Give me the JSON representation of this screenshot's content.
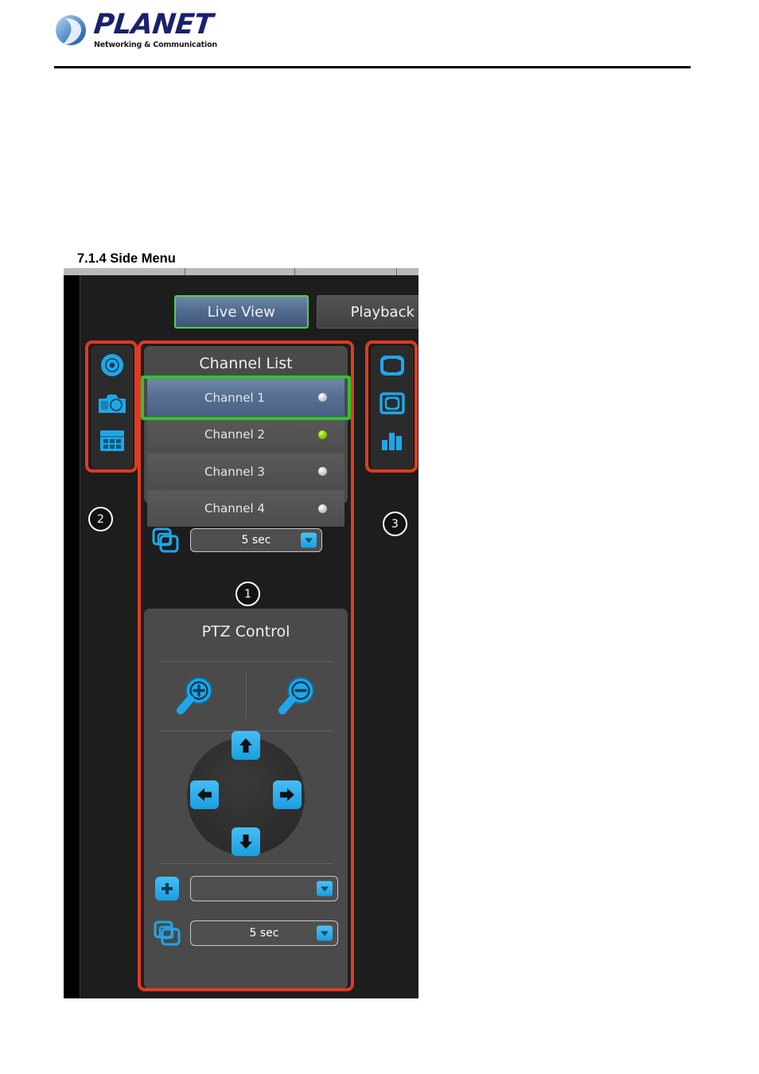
{
  "document": {
    "brand_name": "PLANET",
    "brand_tagline": "Networking & Communication",
    "section_heading": "7.1.4 Side Menu"
  },
  "colors": {
    "accent_blue": "#1a9fe0",
    "annotation_red": "#e03a22",
    "highlight_green": "#2fc42f",
    "status_on_green": "#8ed11a",
    "panel_gray": "#4a4a4a",
    "app_background": "#1d1d1d",
    "selected_row_blue": "#566f93"
  },
  "app": {
    "tabs": [
      {
        "label": "Live View",
        "state": "active"
      },
      {
        "label": "Playback",
        "state": "inactive"
      }
    ],
    "left_rail": {
      "items": [
        {
          "icon": "record-disc-icon",
          "name": "record-button"
        },
        {
          "icon": "camera-snapshot-icon",
          "name": "snapshot-button"
        },
        {
          "icon": "calendar-grid-icon",
          "name": "schedule-button"
        }
      ]
    },
    "right_rail": {
      "items": [
        {
          "icon": "fullscreen-expand-icon",
          "name": "fullscreen-button"
        },
        {
          "icon": "fit-window-icon",
          "name": "fit-window-button"
        },
        {
          "icon": "bar-chart-icon",
          "name": "statistics-button"
        }
      ]
    },
    "channel_list": {
      "title": "Channel List",
      "rows": [
        {
          "label": "Channel 1",
          "selected": true,
          "status": "off"
        },
        {
          "label": "Channel 2",
          "selected": false,
          "status": "on"
        },
        {
          "label": "Channel 3",
          "selected": false,
          "status": "off"
        },
        {
          "label": "Channel 4",
          "selected": false,
          "status": "off"
        }
      ],
      "sequence": {
        "icon": "sequence-tour-icon",
        "dropdown_value": "5 sec"
      }
    },
    "ptz": {
      "title": "PTZ Control",
      "zoom_in": {
        "icon": "zoom-in-magnifier-icon",
        "label": "Zoom In"
      },
      "zoom_out": {
        "icon": "zoom-out-magnifier-icon",
        "label": "Zoom Out"
      },
      "directions": [
        {
          "icon": "arrow-up-icon",
          "name": "ptz-up-button"
        },
        {
          "icon": "arrow-left-icon",
          "name": "ptz-left-button"
        },
        {
          "icon": "arrow-right-icon",
          "name": "ptz-right-button"
        },
        {
          "icon": "arrow-down-icon",
          "name": "ptz-down-button"
        }
      ],
      "preset": {
        "icon": "add-preset-icon",
        "dropdown_value": ""
      },
      "tour": {
        "icon": "sequence-tour-icon",
        "dropdown_value": "5 sec"
      }
    },
    "callouts": [
      {
        "number": "1",
        "target": "channel-list-panel"
      },
      {
        "number": "2",
        "target": "left-icon-rail"
      },
      {
        "number": "3",
        "target": "right-icon-rail"
      }
    ]
  }
}
